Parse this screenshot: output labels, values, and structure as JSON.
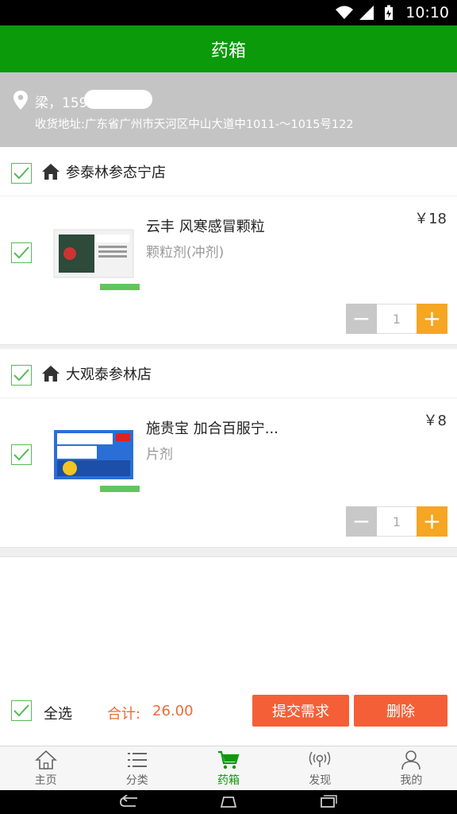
{
  "status_bar": {
    "time": "10:10"
  },
  "header": {
    "title": "药箱"
  },
  "address": {
    "name_phone": "梁，159",
    "detail": "收货地址:广东省广州市天河区中山大道中1011-～1015号122"
  },
  "stores": [
    {
      "name": "参泰林参态宁店",
      "product": {
        "name": "云丰 风寒感冒颗粒",
        "type": "颗粒剂(冲剂)",
        "price": "￥18",
        "quantity": "1"
      }
    },
    {
      "name": "大观泰参林店",
      "product": {
        "name": "施贵宝  加合百服宁...",
        "type": "片剂",
        "price": "￥8",
        "quantity": "1"
      }
    }
  ],
  "footer": {
    "select_all": "全选",
    "total_label": "合计:",
    "total_value": "26.00",
    "submit": "提交需求",
    "delete": "删除"
  },
  "tabs": [
    {
      "label": "主页",
      "icon": "home-outline-icon"
    },
    {
      "label": "分类",
      "icon": "list-icon"
    },
    {
      "label": "药箱",
      "icon": "cart-icon"
    },
    {
      "label": "发现",
      "icon": "radar-icon"
    },
    {
      "label": "我的",
      "icon": "user-icon"
    }
  ],
  "colors": {
    "primary_green": "#0a9a0a",
    "accent_orange": "#f5a623",
    "button_red": "#f55f38",
    "price_orange": "#ef6a3a"
  }
}
